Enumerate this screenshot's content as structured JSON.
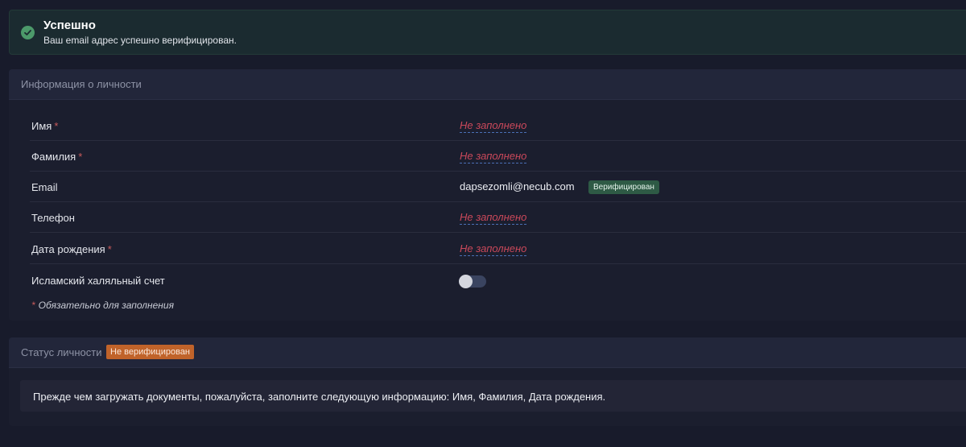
{
  "alert": {
    "title": "Успешно",
    "message": "Ваш email адрес успешно верифицирован.",
    "icon": "check-circle-icon",
    "color": "#4c9a6a"
  },
  "personal": {
    "header": "Информация о личности",
    "rows": [
      {
        "label": "Имя",
        "required": "*",
        "value": "Не заполнено"
      },
      {
        "label": "Фамилия",
        "required": "*",
        "value": "Не заполнено"
      },
      {
        "label": "Email",
        "value": "dapsezomli@necub.com",
        "badge": "Верифицирован"
      },
      {
        "label": "Телефон",
        "value": "Не заполнено"
      },
      {
        "label": "Дата рождения",
        "required": "*",
        "value": "Не заполнено"
      },
      {
        "label": "Исламский халяльный счет",
        "toggle_on": false
      }
    ],
    "required_note_mark": "*",
    "required_note": "Обязательно для заполнения"
  },
  "status": {
    "header": "Статус личности",
    "badge": "Не верифицирован",
    "badge_color": "#c0632a",
    "message": "Прежде чем загружать документы, пожалуйста, заполните следующую информацию: Имя, Фамилия, Дата рождения."
  }
}
